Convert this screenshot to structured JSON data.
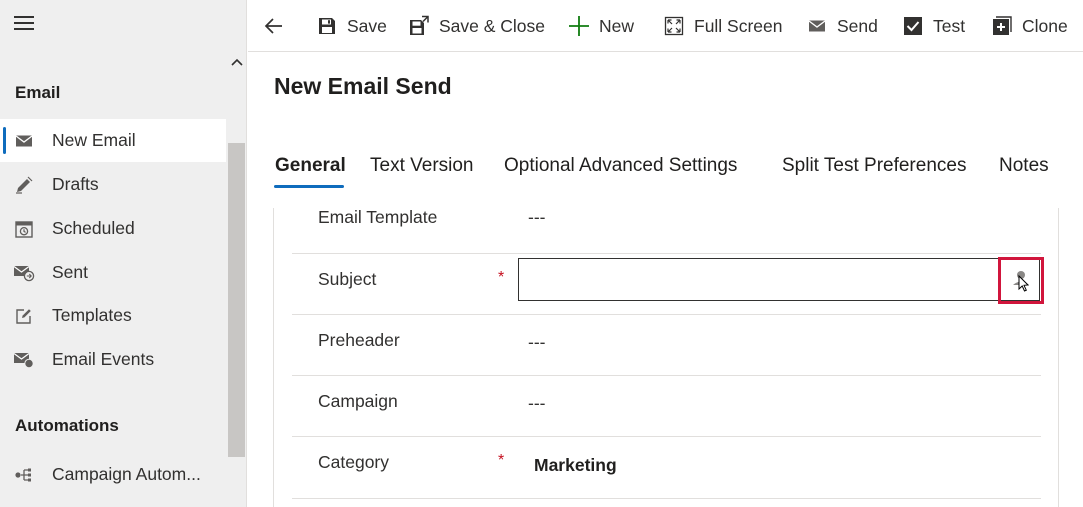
{
  "sidebar": {
    "sections": [
      {
        "heading": "Email",
        "items": [
          {
            "label": "New Email",
            "icon": "mail-icon",
            "active": true
          },
          {
            "label": "Drafts",
            "icon": "edit-icon"
          },
          {
            "label": "Scheduled",
            "icon": "calendar-clock-icon"
          },
          {
            "label": "Sent",
            "icon": "mail-sent-icon"
          },
          {
            "label": "Templates",
            "icon": "template-edit-icon"
          },
          {
            "label": "Email Events",
            "icon": "mail-events-icon"
          }
        ]
      },
      {
        "heading": "Automations",
        "items": [
          {
            "label": "Campaign Autom...",
            "icon": "automation-flow-icon"
          }
        ]
      }
    ]
  },
  "toolbar": {
    "back_icon": "back-arrow-icon",
    "buttons": [
      {
        "label": "Save",
        "icon": "save-icon"
      },
      {
        "label": "Save & Close",
        "icon": "save-close-icon"
      },
      {
        "label": "New",
        "icon": "plus-icon"
      },
      {
        "label": "Full Screen",
        "icon": "fullscreen-icon"
      },
      {
        "label": "Send",
        "icon": "send-mail-icon"
      },
      {
        "label": "Test",
        "icon": "checkbox-icon"
      },
      {
        "label": "Clone",
        "icon": "clone-icon"
      }
    ]
  },
  "main": {
    "title": "New Email Send",
    "tabs": [
      {
        "label": "General",
        "active": true
      },
      {
        "label": "Text Version"
      },
      {
        "label": "Optional Advanced Settings"
      },
      {
        "label": "Split Test Preferences"
      },
      {
        "label": "Notes"
      }
    ],
    "fields": [
      {
        "label": "Email Template",
        "value": "---",
        "required": false
      },
      {
        "label": "Subject",
        "value": "",
        "required": true
      },
      {
        "label": "Preheader",
        "value": "---",
        "required": false
      },
      {
        "label": "Campaign",
        "value": "---",
        "required": false
      },
      {
        "label": "Category",
        "value": "Marketing",
        "required": true
      }
    ],
    "required_marker": "*"
  },
  "colors": {
    "accent": "#0f6cbd",
    "required": "#c50f1f",
    "highlight": "#d1153c",
    "sidebar_bg": "#efefef",
    "new_icon": "#107c10"
  }
}
